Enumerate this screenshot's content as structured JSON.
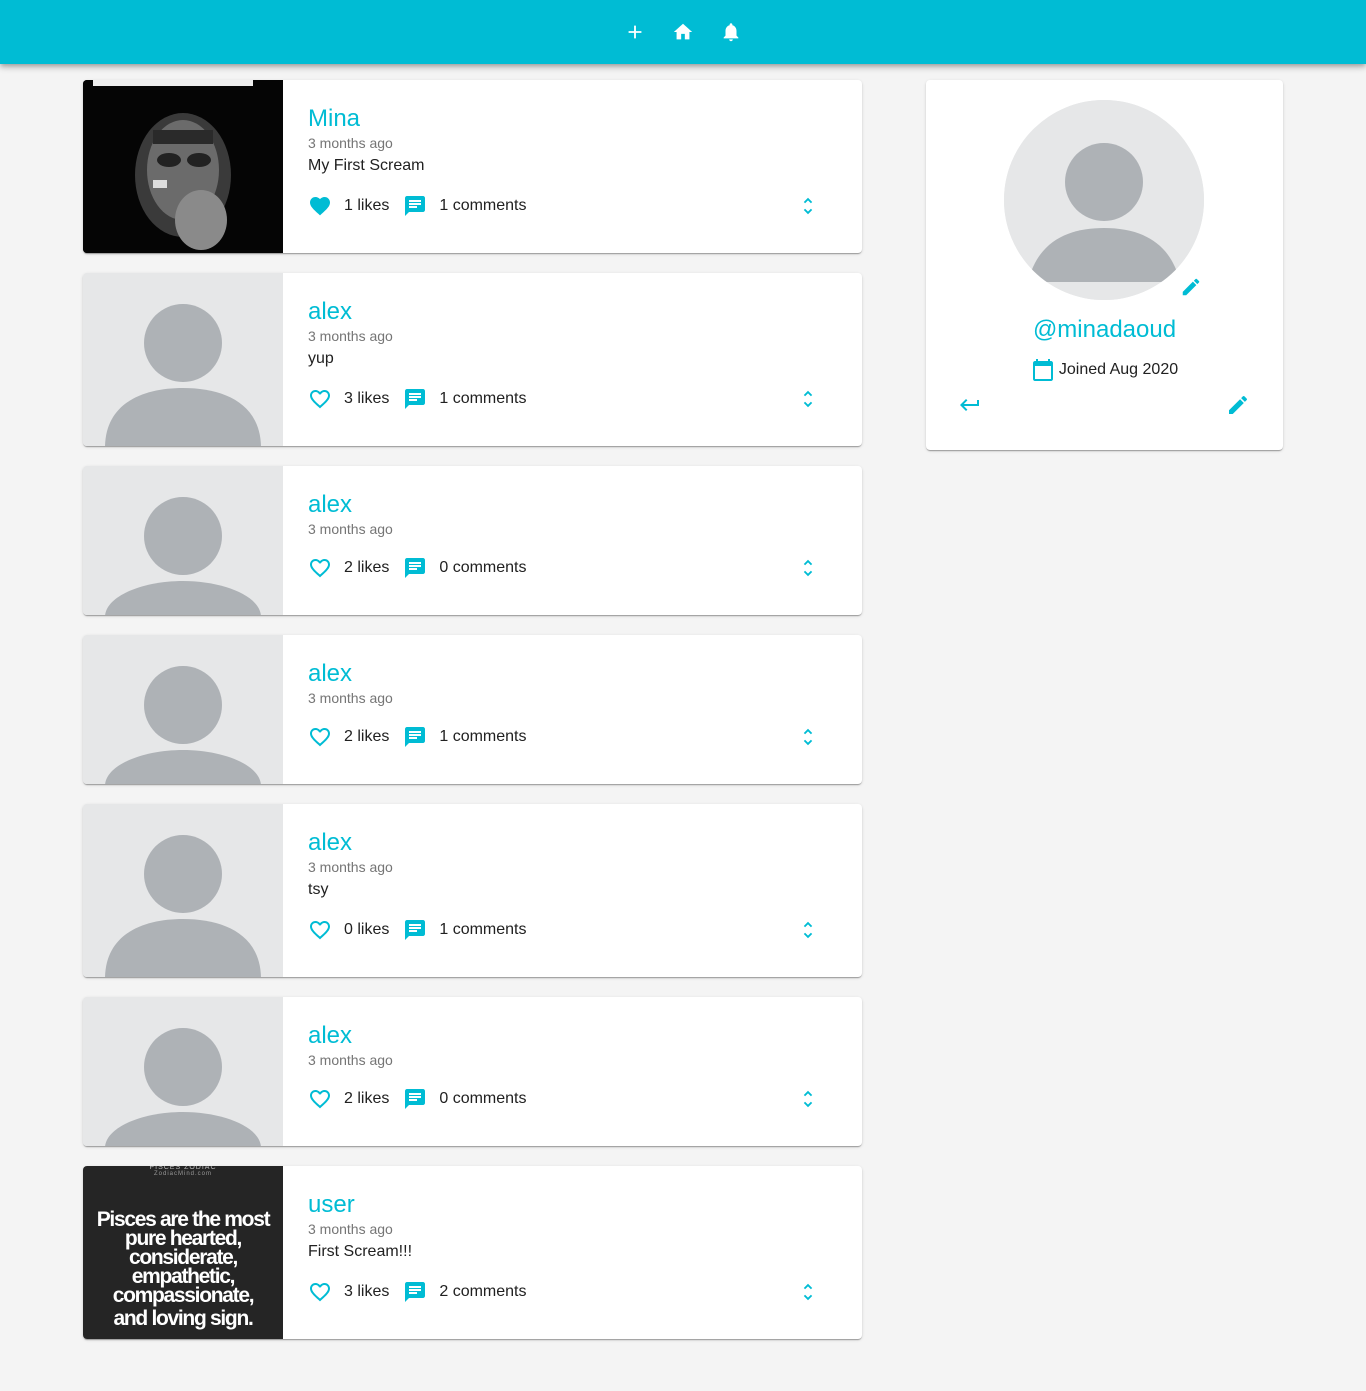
{
  "navbar": {
    "buttons": [
      {
        "icon": "add-icon"
      },
      {
        "icon": "home-icon"
      },
      {
        "icon": "notifications-icon"
      }
    ]
  },
  "posts": [
    {
      "user": "Mina",
      "time": "3 months ago",
      "body": "My First Scream",
      "likes": "1 likes",
      "comments": "1 comments",
      "liked": true,
      "image": "photo"
    },
    {
      "user": "alex",
      "time": "3 months ago",
      "body": "yup",
      "likes": "3 likes",
      "comments": "1 comments",
      "liked": false,
      "image": "placeholder"
    },
    {
      "user": "alex",
      "time": "3 months ago",
      "body": "",
      "likes": "2 likes",
      "comments": "0 comments",
      "liked": false,
      "image": "placeholder"
    },
    {
      "user": "alex",
      "time": "3 months ago",
      "body": "",
      "likes": "2 likes",
      "comments": "1 comments",
      "liked": false,
      "image": "placeholder"
    },
    {
      "user": "alex",
      "time": "3 months ago",
      "body": "tsy",
      "likes": "0 likes",
      "comments": "1 comments",
      "liked": false,
      "image": "placeholder"
    },
    {
      "user": "alex",
      "time": "3 months ago",
      "body": "",
      "likes": "2 likes",
      "comments": "0 comments",
      "liked": false,
      "image": "placeholder"
    },
    {
      "user": "user",
      "time": "3 months ago",
      "body": "First Scream!!!",
      "likes": "3 likes",
      "comments": "2 comments",
      "liked": false,
      "image": "pisces"
    }
  ],
  "pisces_image": {
    "top_text": "PISCES ZODIAC",
    "sub_text": "ZodiacMind.com",
    "lines": [
      "Pisces are the most",
      "pure hearted,",
      "considerate, empathetic,",
      "compassionate,"
    ],
    "last_line": "and loving sign."
  },
  "profile": {
    "handle": "@minadaoud",
    "joined": "Joined Aug 2020"
  },
  "colors": {
    "primary": "#00bcd4",
    "background": "#f4f4f4",
    "placeholder_bg": "#e6e7e8",
    "placeholder_fg": "#aeb2b6"
  }
}
